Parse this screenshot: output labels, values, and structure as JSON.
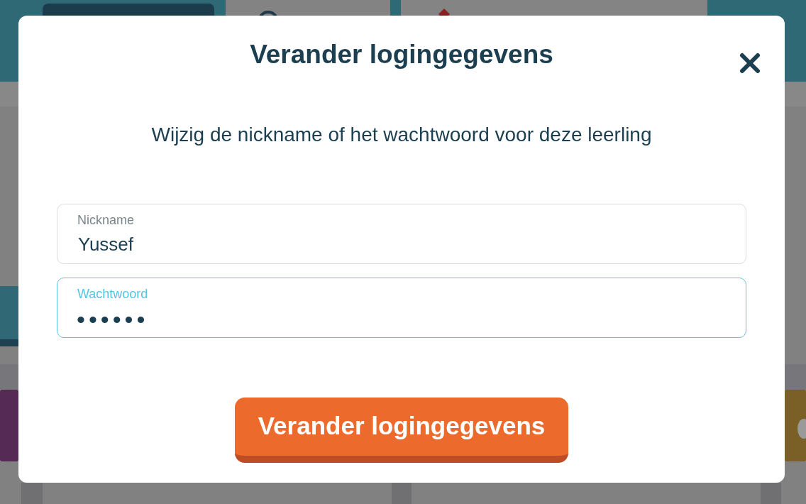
{
  "dialog": {
    "title": "Verander logingegevens",
    "subtitle": "Wijzig de nickname of het wachtwoord voor deze leerling",
    "fields": [
      {
        "kind": "text",
        "label": "Nickname",
        "value": "Yussef",
        "focused": false
      },
      {
        "kind": "password",
        "label": "Wachtwoord",
        "value": "••••••",
        "focused": true
      }
    ],
    "submit_button": "Verander logingegevens"
  }
}
